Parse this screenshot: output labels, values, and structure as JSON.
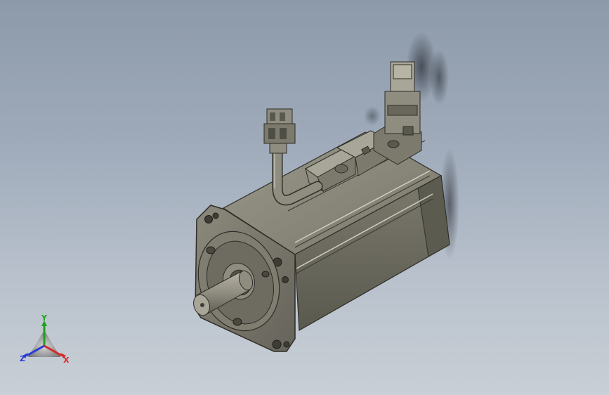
{
  "viewport": {
    "background_top": "#8d9aaa",
    "background_bottom": "#c9cfd6"
  },
  "model": {
    "body_color": "#6e6c60",
    "body_light": "#8f8d80",
    "body_dark": "#4b4a40",
    "shaft_color": "#9a978a"
  },
  "triad": {
    "x_label": "X",
    "y_label": "Y",
    "z_label": "Z",
    "x_color": "#d42a2a",
    "y_color": "#20a020",
    "z_color": "#2a3ad4"
  }
}
